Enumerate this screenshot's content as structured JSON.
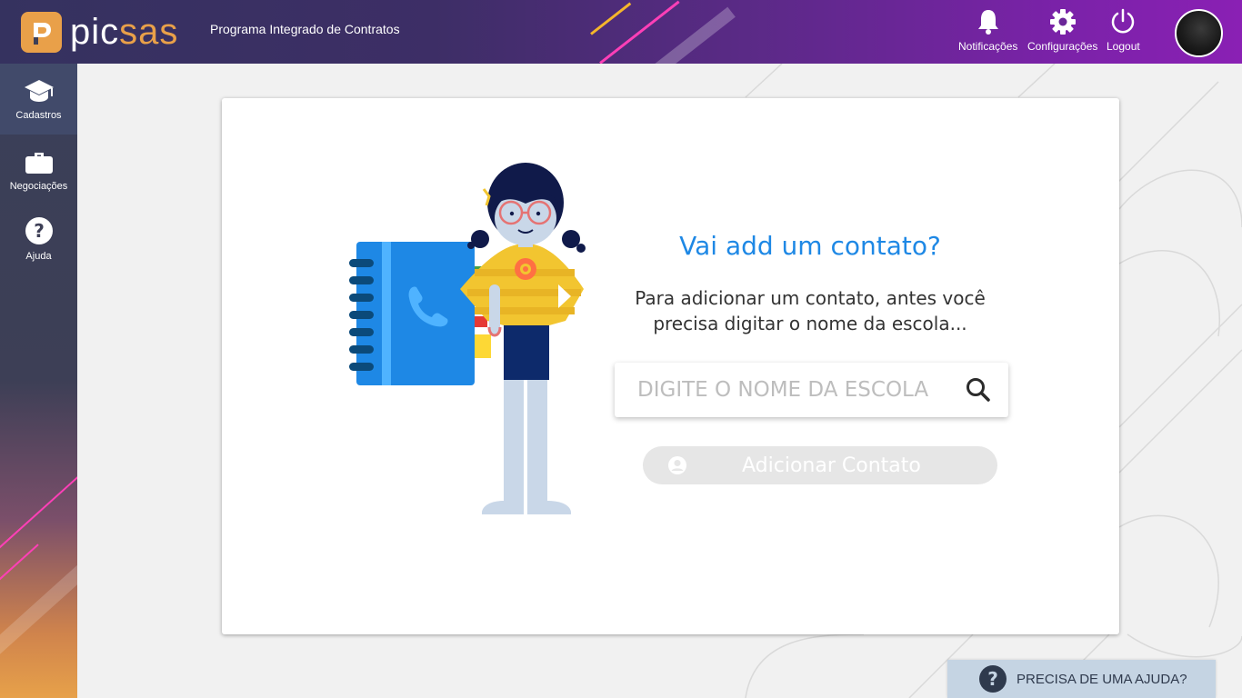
{
  "header": {
    "logo_pic": "pic",
    "logo_sas": "sas",
    "app_title": "Programa Integrado de Contratos",
    "actions": [
      {
        "label": "Notificações",
        "icon": "bell-icon"
      },
      {
        "label": "Configurações",
        "icon": "gear-icon"
      },
      {
        "label": "Logout",
        "icon": "power-icon"
      }
    ]
  },
  "sidebar": {
    "items": [
      {
        "label": "Cadastros",
        "icon": "graduation-cap-icon",
        "active": true
      },
      {
        "label": "Negociações",
        "icon": "briefcase-icon",
        "active": false
      },
      {
        "label": "Ajuda",
        "icon": "help-icon",
        "active": false
      }
    ]
  },
  "main": {
    "heading": "Vai add um contato?",
    "subtext": "Para adicionar um contato, antes você precisa digitar o nome da escola...",
    "search": {
      "placeholder": "DIGITE O NOME DA ESCOLA",
      "value": ""
    },
    "add_button": {
      "label": "Adicionar Contato",
      "enabled": false
    }
  },
  "help": {
    "label": "PRECISA DE UMA AJUDA?"
  },
  "colors": {
    "accent": "#1e88e5",
    "brand_orange": "#e9a049",
    "header_purple": "#7a22a8",
    "sidebar_dark": "#3a3f58"
  }
}
